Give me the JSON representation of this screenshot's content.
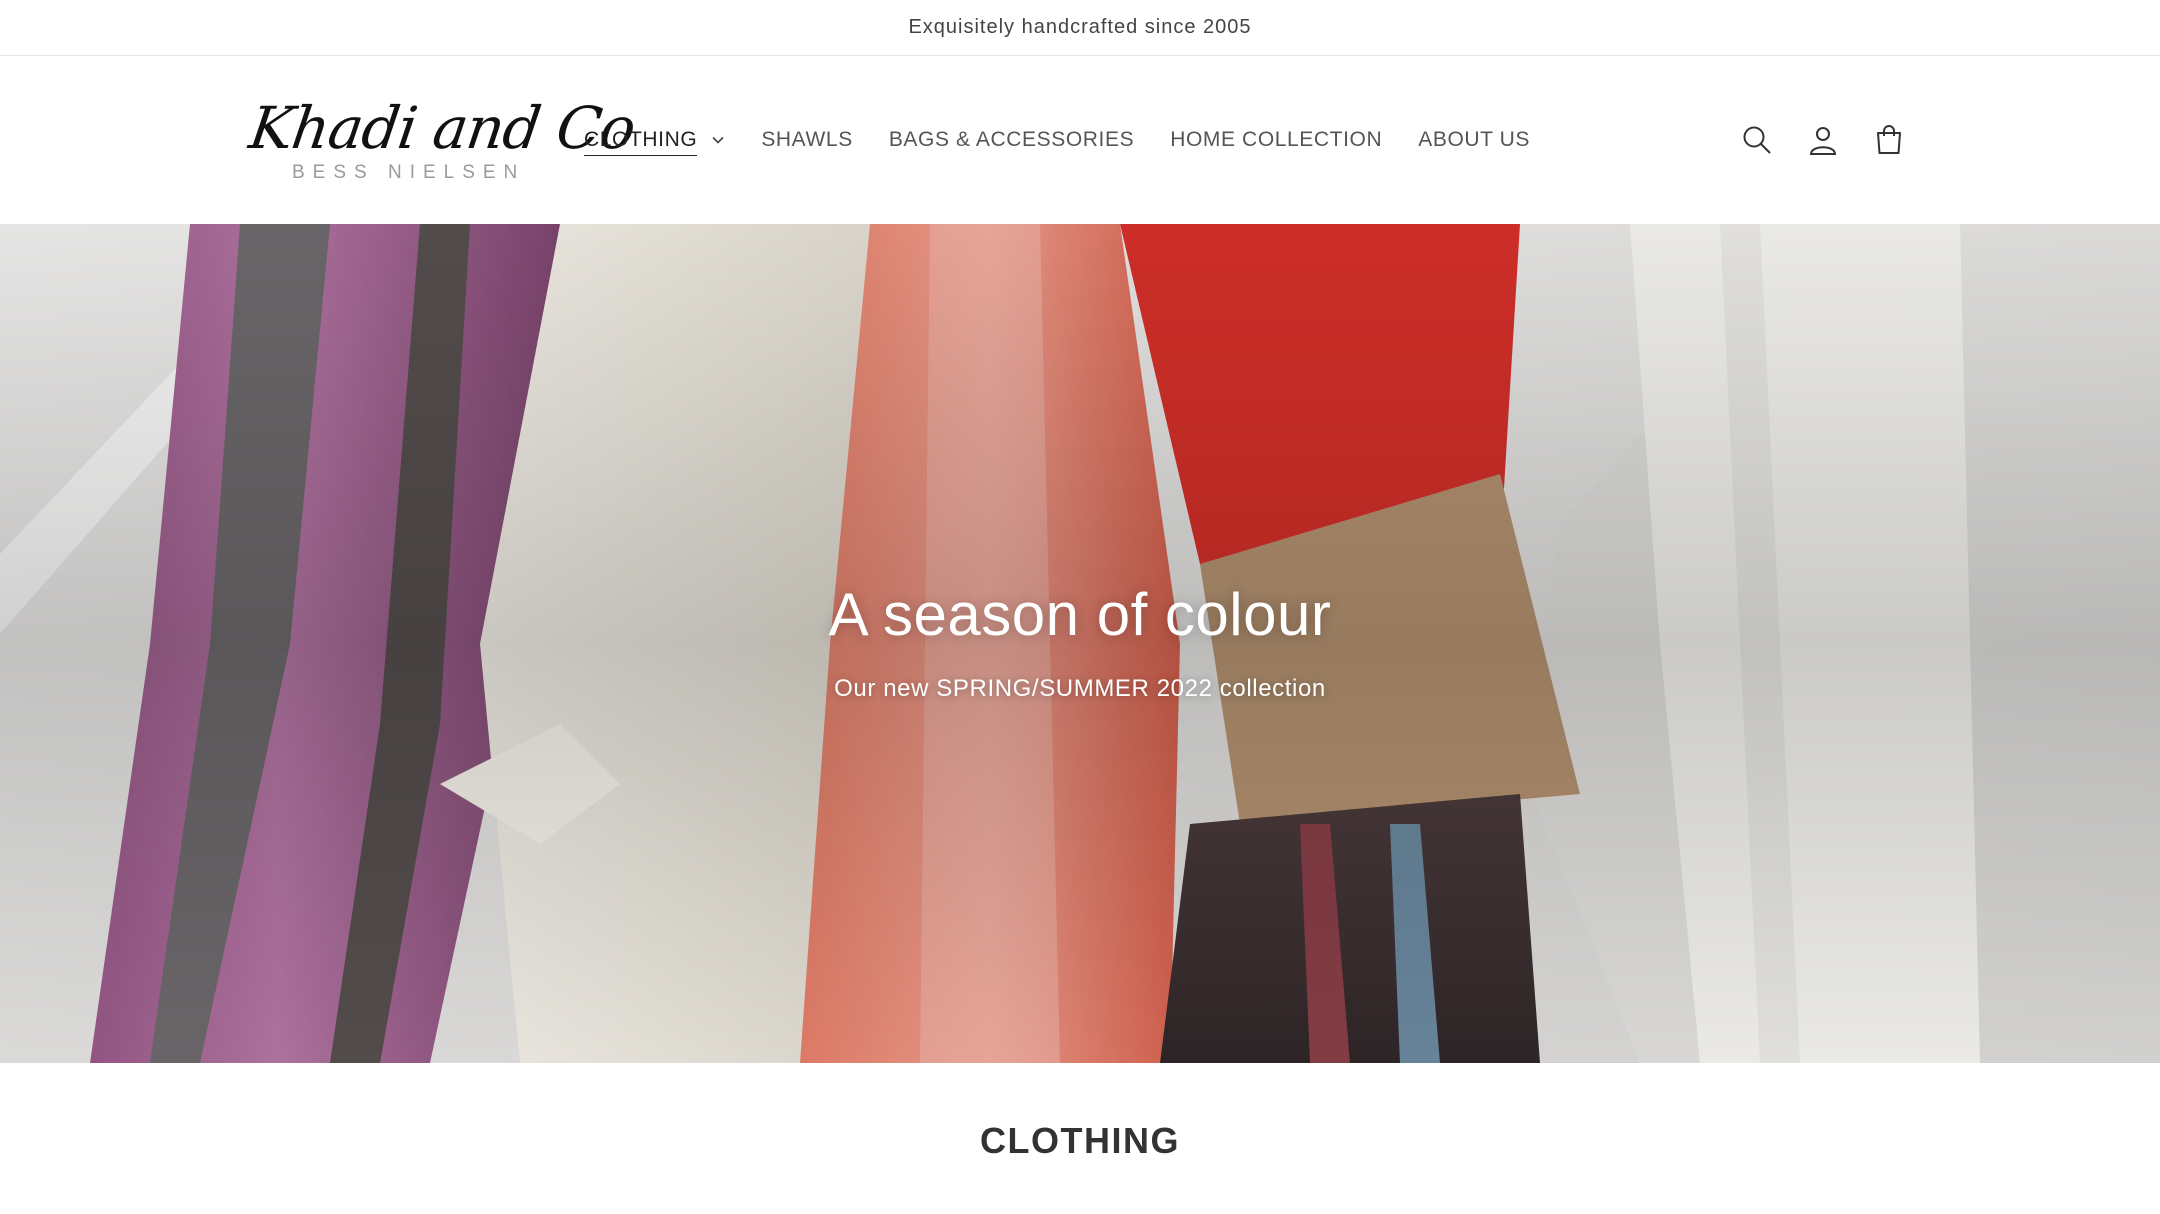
{
  "announcement": "Exquisitely handcrafted since 2005",
  "brand": {
    "logo_script": "Khadi and Co",
    "logo_sub": "BESS NIELSEN"
  },
  "nav": {
    "items": [
      {
        "label": "CLOTHING",
        "active": true,
        "has_dropdown": true
      },
      {
        "label": "SHAWLS"
      },
      {
        "label": "BAGS & ACCESSORIES"
      },
      {
        "label": "HOME COLLECTION"
      },
      {
        "label": "ABOUT US"
      }
    ]
  },
  "header_icons": [
    "search-icon",
    "account-icon",
    "cart-icon"
  ],
  "hero": {
    "title": "A season of colour",
    "subtitle": "Our new SPRING/SUMMER 2022 collection"
  },
  "section": {
    "title": "CLOTHING"
  },
  "colors": {
    "text": "#333333",
    "accent": "#222222"
  }
}
